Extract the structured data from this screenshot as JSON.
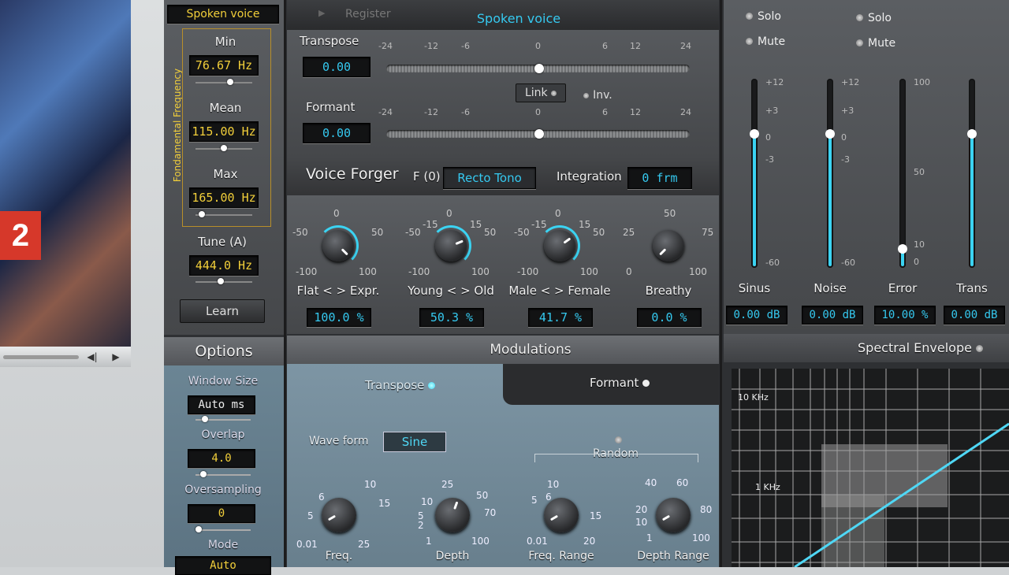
{
  "left_column": {
    "preset": "Spoken voice",
    "axis_label": "Fondamental Frequency",
    "min_label": "Min",
    "min_value": "76.67 Hz",
    "mean_label": "Mean",
    "mean_value": "115.00 Hz",
    "max_label": "Max",
    "max_value": "165.00 Hz",
    "tune_label": "Tune (A)",
    "tune_value": "444.0 Hz",
    "learn_label": "Learn",
    "options_title": "Options",
    "window_size_label": "Window Size",
    "window_size_value": "Auto ms",
    "overlap_label": "Overlap",
    "overlap_value": "4.0",
    "oversampling_label": "Oversampling",
    "oversampling_value": "0",
    "mode_label": "Mode",
    "mode_value": "Auto"
  },
  "top_bar": {
    "register_label": "Register",
    "preset_title": "Spoken voice"
  },
  "pitch": {
    "transpose_label": "Transpose",
    "transpose_value": "0.00",
    "formant_label": "Formant",
    "formant_value": "0.00",
    "scale": [
      "-24",
      "-12",
      "-6",
      "0",
      "6",
      "12",
      "24"
    ],
    "link_label": "Link",
    "inv_label": "Inv."
  },
  "forger": {
    "title": "Voice Forger",
    "f0_label": "F (0)",
    "f0_mode": "Recto Tono",
    "integration_label": "Integration",
    "integration_value": "0 frm",
    "knobs": [
      {
        "name": "Flat < > Expr.",
        "value": "100.0 %",
        "top": "0",
        "left": "-50",
        "right": "50",
        "bl": "-100",
        "br": "100",
        "level": 1.0
      },
      {
        "name": "Young < > Old",
        "value": "50.3 %",
        "top": "0",
        "left": "-50",
        "right": "50",
        "tl": "-15",
        "tr": "15",
        "bl": "-100",
        "br": "100",
        "level": 0.75
      },
      {
        "name": "Male < > Female",
        "value": "41.7 %",
        "top": "0",
        "left": "-50",
        "right": "50",
        "tl": "-15",
        "tr": "15",
        "bl": "-100",
        "br": "100",
        "level": 0.7
      },
      {
        "name": "Breathy",
        "value": "0.0 %",
        "top": "50",
        "left": "25",
        "right": "75",
        "bl": "0",
        "br": "100",
        "level": 0.0
      }
    ]
  },
  "mixer": {
    "solo_label": "Solo",
    "mute_label": "Mute",
    "channels": [
      {
        "name": "Sinus",
        "value": "0.00 dB",
        "scale": [
          "+12",
          "+3",
          "0",
          "-3",
          "-60"
        ],
        "level": 0.72
      },
      {
        "name": "Noise",
        "value": "0.00 dB",
        "scale": [
          "+12",
          "+3",
          "0",
          "-3",
          "-60"
        ],
        "level": 0.72
      },
      {
        "name": "Error",
        "value": "10.00 %",
        "scale": [
          "100",
          "50",
          "10",
          "0"
        ],
        "level": 0.1
      },
      {
        "name": "Trans",
        "value": "0.00 dB",
        "scale": [],
        "level": 0.72
      }
    ]
  },
  "modulations": {
    "title": "Modulations",
    "transpose_tab": "Transpose",
    "formant_tab": "Formant",
    "waveform_label": "Wave form",
    "waveform_value": "Sine",
    "random_label": "Random",
    "knobs": [
      {
        "name": "Freq.",
        "marks": [
          "10",
          "6",
          "15",
          "5",
          "0.01",
          "25"
        ]
      },
      {
        "name": "Depth",
        "marks": [
          "25",
          "10",
          "50",
          "5",
          "70",
          "2",
          "1",
          "100"
        ]
      },
      {
        "name": "Freq. Range",
        "marks": [
          "10",
          "6",
          "5",
          "15",
          "0.01",
          "20"
        ]
      },
      {
        "name": "Depth Range",
        "marks": [
          "40",
          "60",
          "20",
          "80",
          "10",
          "1",
          "100"
        ]
      }
    ]
  },
  "spectral": {
    "title": "Spectral Envelope",
    "label_10k": "10 KHz",
    "label_1k": "1 KHz"
  },
  "colors": {
    "accent": "#35c9f0",
    "lcd_yellow": "#f2cf3a"
  }
}
